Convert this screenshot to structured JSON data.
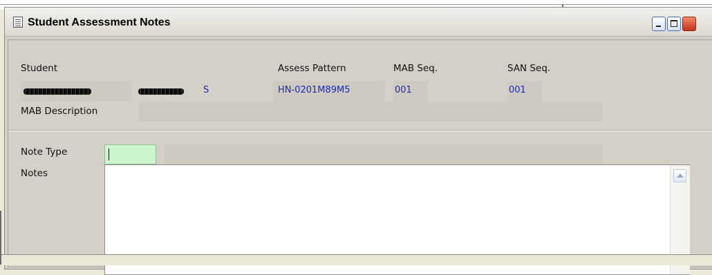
{
  "window": {
    "title": "Student Assessment Notes",
    "controls": {
      "minimize_icon": "minimize-icon",
      "maximize_icon": "maximize-icon",
      "close_icon": "close-icon"
    }
  },
  "header": {
    "student_label": "Student",
    "student_suffix": "S",
    "assess_pattern_label": "Assess Pattern",
    "assess_pattern_value": "HN-0201M89M5",
    "mab_seq_label": "MAB Seq.",
    "mab_seq_value": "001",
    "san_seq_label": "SAN Seq.",
    "san_seq_value": "001",
    "mab_description_label": "MAB Description",
    "mab_description_value": ""
  },
  "notes": {
    "note_type_label": "Note Type",
    "note_type_value": "",
    "note_type_description": "",
    "notes_label": "Notes",
    "notes_value": ""
  },
  "colors": {
    "value_text": "#1a2bb0",
    "readonly_field": "#cfcac1",
    "active_input": "#ccf5cc"
  }
}
